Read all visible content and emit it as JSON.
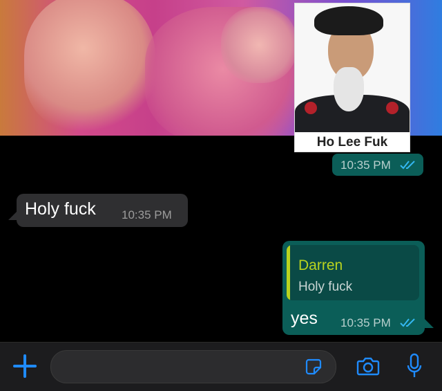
{
  "chat": {
    "image_message": {
      "caption": "Ho Lee Fuk",
      "time": "10:35 PM"
    },
    "incoming": {
      "text": "Holy fuck",
      "time": "10:35 PM"
    },
    "outgoing_reply": {
      "quoted_author": "Darren",
      "quoted_text": "Holy fuck",
      "text": "yes",
      "time": "10:35 PM"
    }
  },
  "composer": {
    "placeholder": ""
  },
  "colors": {
    "accent": "#1f8bff",
    "outgoing_bubble": "#0b5e58",
    "incoming_bubble": "#2f2f31",
    "quote_bar": "#b9d31f"
  },
  "icons": [
    "plus-icon",
    "sticker-icon",
    "camera-icon",
    "mic-icon",
    "double-check-icon"
  ]
}
